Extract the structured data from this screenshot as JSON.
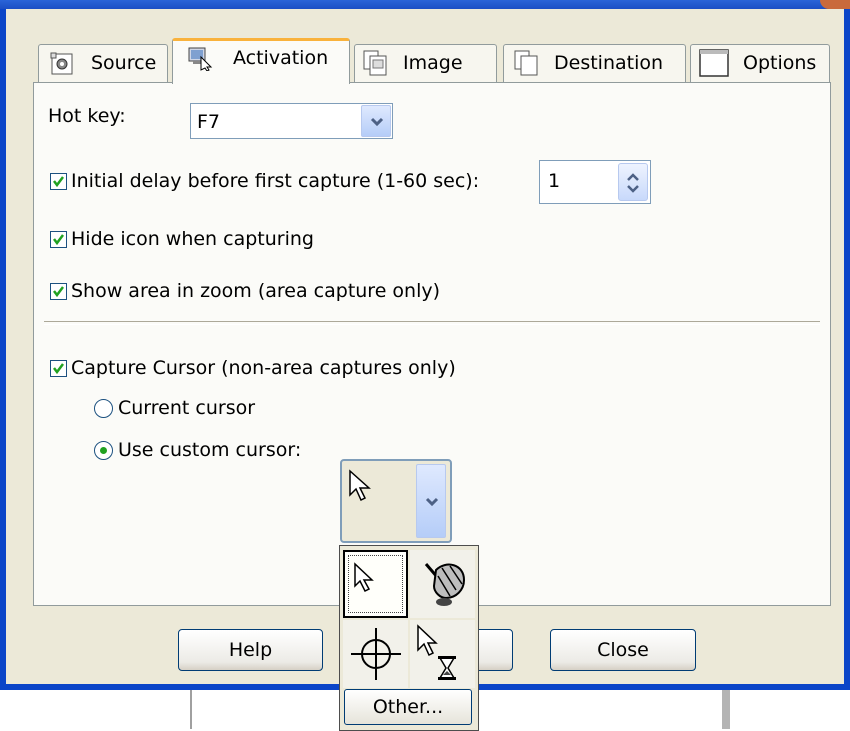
{
  "tabs": [
    {
      "label": "Source"
    },
    {
      "label": "Activation"
    },
    {
      "label": "Image"
    },
    {
      "label": "Destination"
    },
    {
      "label": "Options"
    }
  ],
  "hotkey": {
    "label": "Hot key:",
    "value": "F7"
  },
  "options": {
    "initial_delay_label": "Initial delay before first capture (1-60 sec):",
    "initial_delay_value": "1",
    "hide_icon_label": "Hide icon when capturing",
    "show_zoom_label": "Show area in zoom (area capture only)",
    "capture_cursor_label": "Capture Cursor (non-area captures only)",
    "current_cursor_label": "Current cursor",
    "custom_cursor_label": "Use custom cursor:"
  },
  "popup": {
    "other_label": "Other..."
  },
  "buttons": {
    "help": "Help",
    "close": "Close"
  },
  "icons": {
    "source": "source-tab-icon",
    "activation": "activation-tab-icon",
    "image": "image-tab-icon",
    "destination": "destination-tab-icon",
    "options": "options-tab-icon"
  },
  "colors": {
    "titlebar": "#1b4fc4",
    "active_tab_accent": "#f9b23c",
    "check": "#21a121",
    "dialog_bg": "#ece9d8"
  }
}
